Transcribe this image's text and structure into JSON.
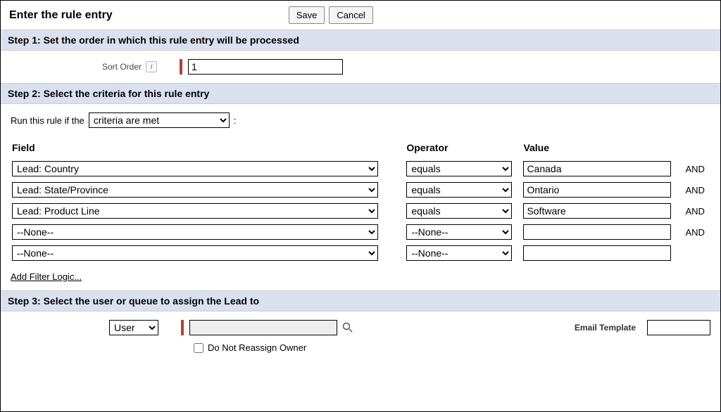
{
  "header": {
    "title": "Enter the rule entry",
    "save_label": "Save",
    "cancel_label": "Cancel"
  },
  "step1": {
    "title": "Step 1: Set the order in which this rule entry will be processed",
    "sort_order_label": "Sort Order",
    "sort_order_value": "1"
  },
  "step2": {
    "title": "Step 2: Select the criteria for this rule entry",
    "run_if_prefix": "Run this rule if the",
    "run_if_value": "criteria are met",
    "run_if_suffix": ":",
    "col_field": "Field",
    "col_operator": "Operator",
    "col_value": "Value",
    "rows": [
      {
        "field": "Lead: Country",
        "operator": "equals",
        "value": "Canada",
        "and": "AND"
      },
      {
        "field": "Lead: State/Province",
        "operator": "equals",
        "value": "Ontario",
        "and": "AND"
      },
      {
        "field": "Lead: Product Line",
        "operator": "equals",
        "value": "Software",
        "and": "AND"
      },
      {
        "field": "--None--",
        "operator": "--None--",
        "value": "",
        "and": "AND"
      },
      {
        "field": "--None--",
        "operator": "--None--",
        "value": "",
        "and": ""
      }
    ],
    "add_filter_logic": "Add Filter Logic..."
  },
  "step3": {
    "title": "Step 3: Select the user or queue to assign the Lead to",
    "assign_type": "User",
    "assign_user": "",
    "email_template_label": "Email Template",
    "email_template_value": "",
    "do_not_reassign_label": "Do Not Reassign Owner"
  }
}
